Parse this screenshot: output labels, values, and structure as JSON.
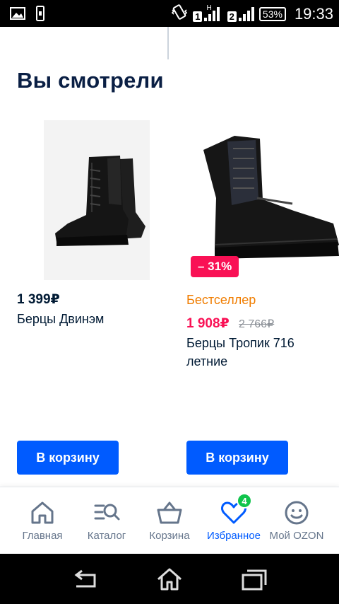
{
  "status_bar": {
    "sim1": "1",
    "sim2": "2",
    "network_letter": "H",
    "battery": "53%",
    "time": "19:33"
  },
  "section": {
    "title": "Вы смотрели"
  },
  "products": [
    {
      "price": "1 399₽",
      "name": "Берцы Двинэм",
      "cart_label": "В корзину"
    },
    {
      "discount": "– 31%",
      "badge": "Бестселлер",
      "price": "1 908₽",
      "old_price": "2 766₽",
      "name": "Берцы Тропик 716 летние",
      "cart_label": "В корзину"
    }
  ],
  "bottom_nav": {
    "items": [
      {
        "label": "Главная",
        "icon": "home-icon"
      },
      {
        "label": "Каталог",
        "icon": "catalog-search-icon"
      },
      {
        "label": "Корзина",
        "icon": "basket-icon"
      },
      {
        "label": "Избранное",
        "icon": "heart-icon",
        "badge": "4",
        "active": true
      },
      {
        "label": "Мой OZON",
        "icon": "smile-icon"
      }
    ]
  },
  "colors": {
    "accent": "#005bff",
    "discount": "#f91155",
    "bestseller": "#f07d00",
    "badge_green": "#10c44c",
    "text_dark": "#001a34"
  }
}
